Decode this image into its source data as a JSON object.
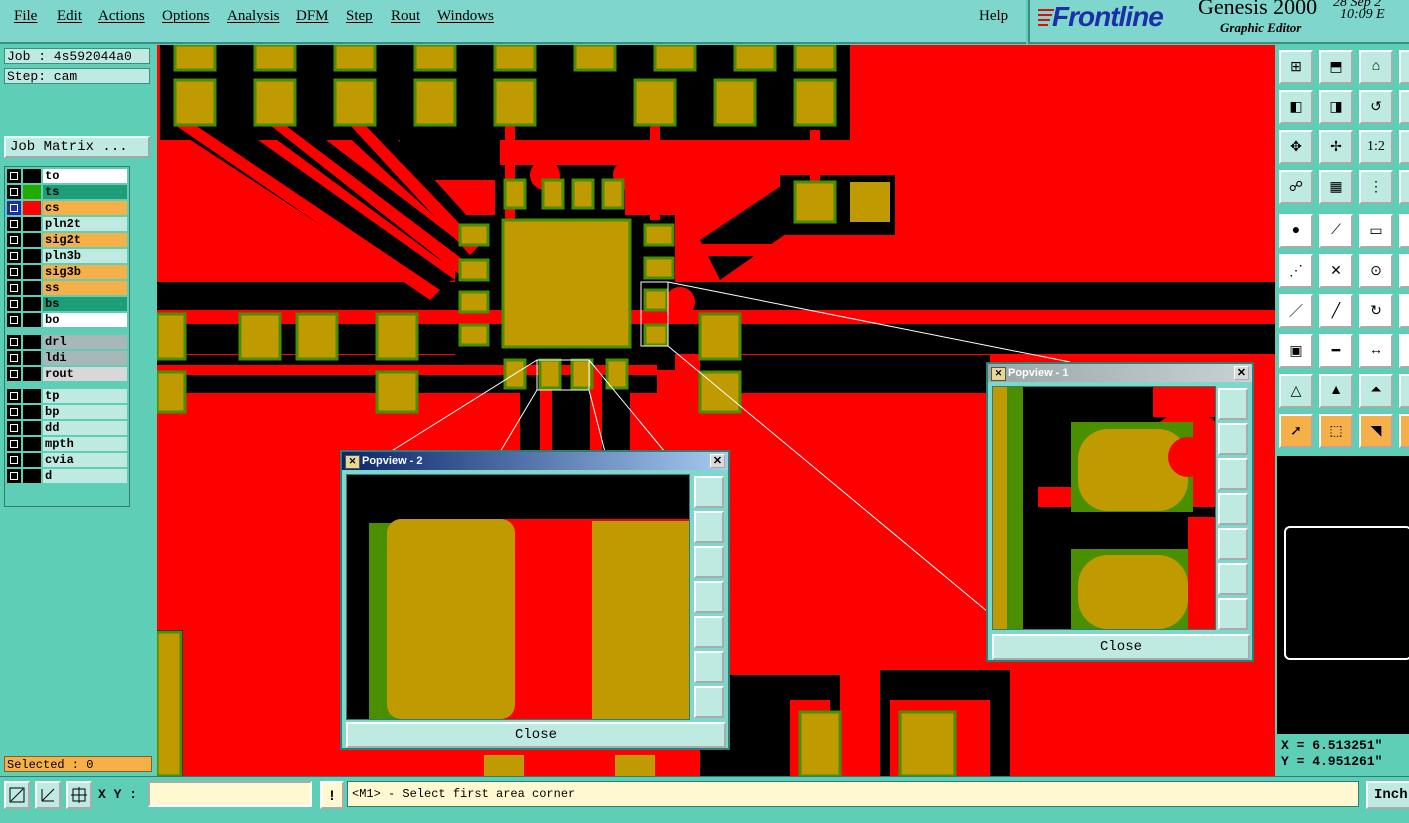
{
  "menubar": {
    "items": [
      "File",
      "Edit",
      "Actions",
      "Options",
      "Analysis",
      "DFM",
      "Step",
      "Rout",
      "Windows"
    ],
    "help": "Help"
  },
  "brand": {
    "logo": "Frontline",
    "product": "Genesis 2000",
    "subtitle": "Graphic Editor",
    "date": "28 Sep 2",
    "time": "10:09 E"
  },
  "left": {
    "job": "Job : 4s592044a0",
    "step": "Step: cam",
    "job_matrix": "Job Matrix ...",
    "layers": [
      {
        "name": "to",
        "color": "#ffffff",
        "swatch": "#000000",
        "flag": "🖊"
      },
      {
        "name": "ts",
        "color": "#1e9e78",
        "swatch": "#22aa00",
        "flag": "🖊"
      },
      {
        "name": "cs",
        "color": "#f5b04a",
        "swatch": "#ff0000",
        "flag": "🖊⊞",
        "active": true
      },
      {
        "name": "pln2t",
        "color": "#bfeae2",
        "swatch": "#000000",
        "flag": ""
      },
      {
        "name": "sig2t",
        "color": "#f5b04a",
        "swatch": "#000000",
        "flag": "🖊"
      },
      {
        "name": "pln3b",
        "color": "#bfeae2",
        "swatch": "#000000",
        "flag": ""
      },
      {
        "name": "sig3b",
        "color": "#f5b04a",
        "swatch": "#000000",
        "flag": "🖊"
      },
      {
        "name": "ss",
        "color": "#f5b04a",
        "swatch": "#000000",
        "flag": "🖊"
      },
      {
        "name": "bs",
        "color": "#1e9e78",
        "swatch": "#000000",
        "flag": "🖊"
      },
      {
        "name": "bo",
        "color": "#ffffff",
        "swatch": "#000000",
        "flag": "🖊"
      },
      {
        "name": "drl",
        "color": "#a8b8b8",
        "swatch": "#000000",
        "flag": ""
      },
      {
        "name": "ldi",
        "color": "#a8b8b8",
        "swatch": "#000000",
        "flag": ""
      },
      {
        "name": "rout",
        "color": "#d8d8d8",
        "swatch": "#000000",
        "flag": ""
      },
      {
        "name": "tp",
        "color": "#bfeae2",
        "swatch": "#000000",
        "flag": "🖊"
      },
      {
        "name": "bp",
        "color": "#bfeae2",
        "swatch": "#000000",
        "flag": "🖊"
      },
      {
        "name": "dd",
        "color": "#bfeae2",
        "swatch": "#000000",
        "flag": "🖊"
      },
      {
        "name": "mpth",
        "color": "#bfeae2",
        "swatch": "#000000",
        "flag": ""
      },
      {
        "name": "cvia",
        "color": "#bfeae2",
        "swatch": "#000000",
        "flag": ""
      },
      {
        "name": "d",
        "color": "#bfeae2",
        "swatch": "#000000",
        "flag": ""
      }
    ],
    "selected": "Selected : 0"
  },
  "popview1": {
    "title": "Popview - 1",
    "close": "Close"
  },
  "popview2": {
    "title": "Popview - 2",
    "close": "Close"
  },
  "coords": {
    "x": "X = 6.513251\"",
    "y": "Y = 4.951261\""
  },
  "status": {
    "xy_label": "X Y :",
    "xy_value": "",
    "prompt": "<M1> - Select first area corner",
    "units": "Inch"
  },
  "colors": {
    "board": "#ff0000",
    "pad": "#bf9a00",
    "mask": "#4a8f00",
    "background": "#000000",
    "panel": "#5ecfb6"
  }
}
